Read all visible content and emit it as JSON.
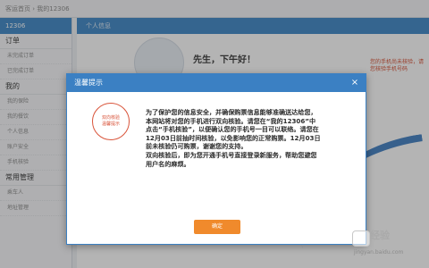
{
  "topbar": {
    "breadcrumb": "客运首页 › 我的12306"
  },
  "sidebar": {
    "header": "12306",
    "groups": [
      {
        "label": "订单",
        "items": [
          "未完成订单",
          "已完成订单"
        ]
      },
      {
        "label": "我的",
        "items": [
          "我的保险",
          "我的餐饮",
          "个人信息",
          "账户安全",
          "手机核验"
        ]
      },
      {
        "label": "常用管理",
        "items": [
          "乘车人",
          "地址管理"
        ]
      }
    ]
  },
  "main": {
    "header": "个人信息",
    "welcome": "先生，下午好！",
    "side_notice": "您的手机尚未核验，请您核验手机号码"
  },
  "modal": {
    "title": "温馨提示",
    "close": "×",
    "stamp_line1": "双向核验",
    "stamp_line2": "温馨提示",
    "paragraph1": "为了保护您的信息安全，并确保购票信息能够准确送达给您，本网站将对您的手机进行双向核验。请您在“我的12306”中点击“手机核验”，以便确认您的手机号一目可以联络。请您在12月03日前抽时间核验，以免影响您的正常购票。12月03日前未核验仍可购票，谢谢您的支持。",
    "paragraph2": "双向核验后，即为您开通手机号直接登录新服务，帮助您避您用户名的麻烦。",
    "ok_label": "确定"
  },
  "watermark": {
    "text": "经验",
    "url": "jingyan.baidu.com"
  },
  "colors": {
    "accent": "#3b80c3",
    "button": "#f08a2c",
    "stamp": "#d9543a"
  }
}
